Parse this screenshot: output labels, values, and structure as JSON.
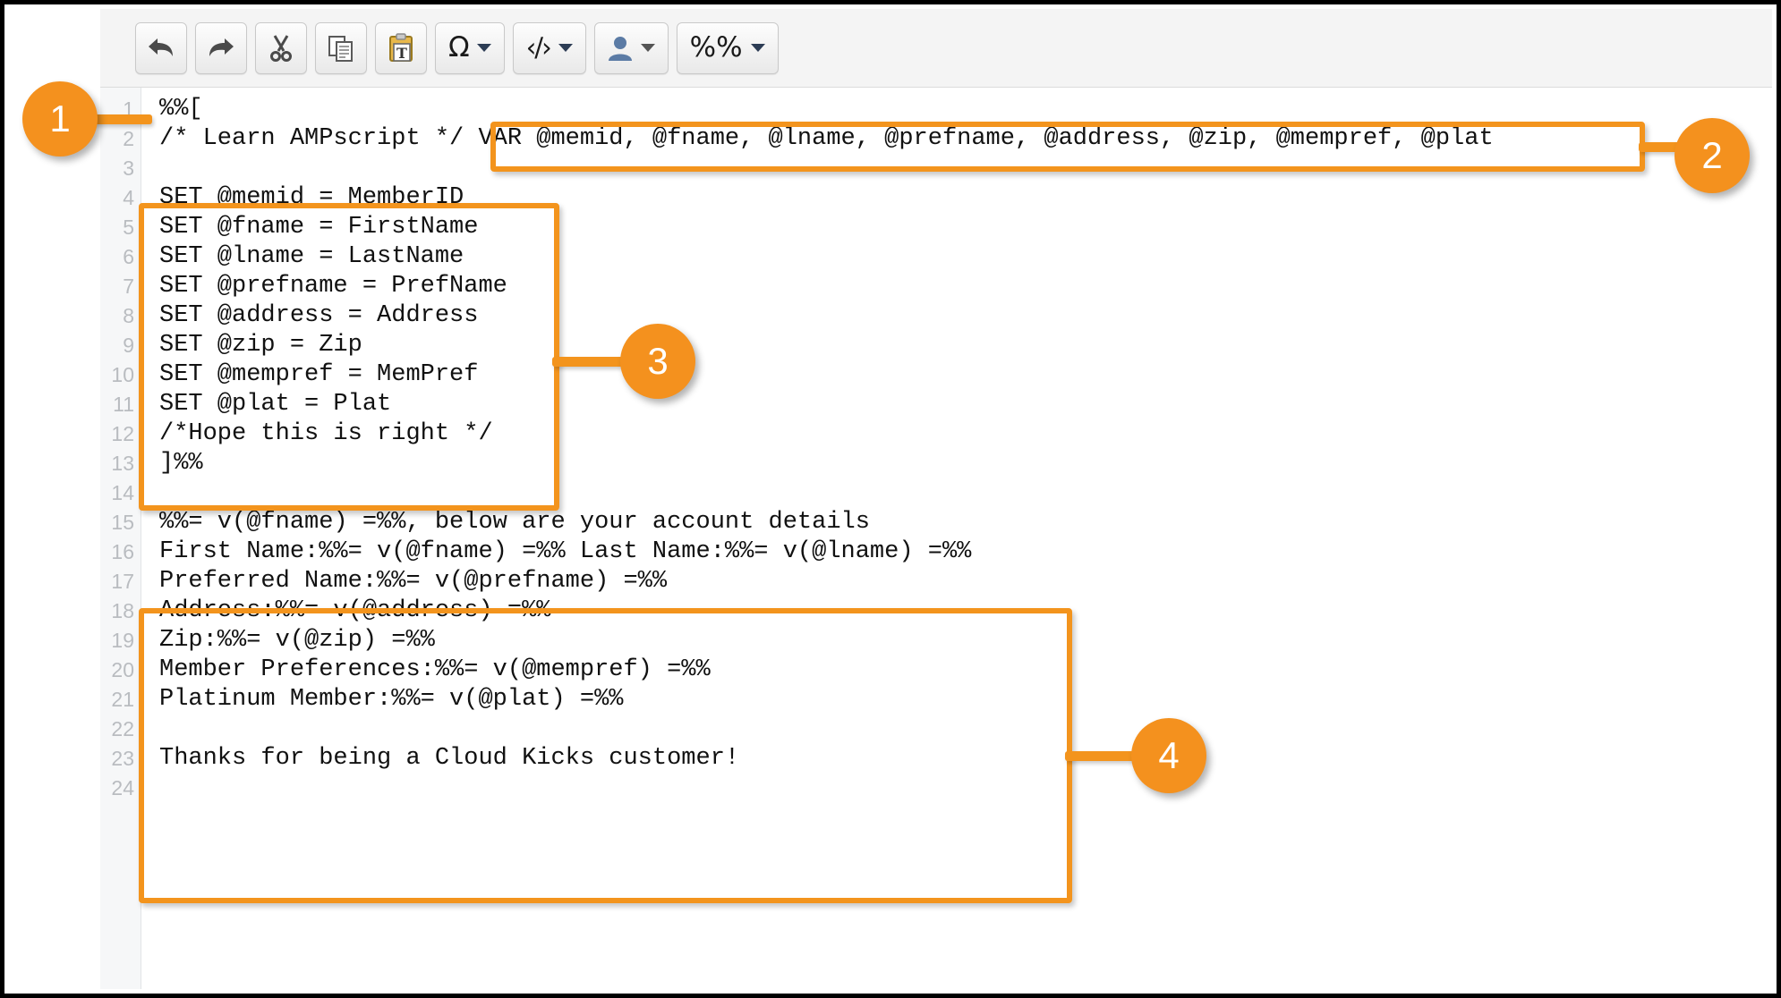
{
  "toolbar": {
    "buttons": [
      {
        "name": "undo-button",
        "icon": "undo-arrow-icon",
        "label": "",
        "caret": false
      },
      {
        "name": "redo-button",
        "icon": "redo-arrow-icon",
        "label": "",
        "caret": false
      },
      {
        "name": "cut-button",
        "icon": "scissors-icon",
        "label": "",
        "caret": false
      },
      {
        "name": "copy-button",
        "icon": "copy-documents-icon",
        "label": "",
        "caret": false
      },
      {
        "name": "paste-as-text-button",
        "icon": "clipboard-text-icon",
        "label": "",
        "caret": false
      },
      {
        "name": "special-character-button",
        "icon": "omega-icon",
        "label": "Ω",
        "caret": true
      },
      {
        "name": "source-code-button",
        "icon": "code-brackets-icon",
        "label": "‹/›",
        "caret": true
      },
      {
        "name": "personalization-button",
        "icon": "person-icon",
        "label": "",
        "caret": true
      },
      {
        "name": "ampscript-button",
        "icon": "percent-percent-icon",
        "label": "%%",
        "caret": true
      }
    ]
  },
  "editor": {
    "line_numbers": [
      "1",
      "2",
      "3",
      "4",
      "5",
      "6",
      "7",
      "8",
      "9",
      "10",
      "11",
      "12",
      "13",
      "14",
      "15",
      "16",
      "17",
      "18",
      "19",
      "20",
      "21",
      "22",
      "23",
      "24"
    ],
    "lines": [
      {
        "n": "1",
        "text": "%%["
      },
      {
        "n": "2",
        "text": "/* Learn AMPscript */ VAR @memid, @fname, @lname, @prefname, @address, @zip, @mempref, @plat"
      },
      {
        "n": "3",
        "text": ""
      },
      {
        "n": "4",
        "text": "SET @memid = MemberID"
      },
      {
        "n": "5",
        "text": "SET @fname = FirstName"
      },
      {
        "n": "6",
        "text": "SET @lname = LastName"
      },
      {
        "n": "7",
        "text": "SET @prefname = PrefName"
      },
      {
        "n": "8",
        "text": "SET @address = Address"
      },
      {
        "n": "9",
        "text": "SET @zip = Zip"
      },
      {
        "n": "10",
        "text": "SET @mempref = MemPref"
      },
      {
        "n": "11",
        "text": "SET @plat = Plat"
      },
      {
        "n": "12",
        "text": "/*Hope this is right */"
      },
      {
        "n": "13",
        "text": "]%%"
      },
      {
        "n": "14",
        "text": ""
      },
      {
        "n": "15",
        "text": "%%= v(@fname) =%%, below are your account details"
      },
      {
        "n": "16",
        "text": "First Name:%%= v(@fname) =%% Last Name:%%= v(@lname) =%%"
      },
      {
        "n": "17",
        "text": "Preferred Name:%%= v(@prefname) =%%"
      },
      {
        "n": "18",
        "text": "Address:%%= v(@address) =%%"
      },
      {
        "n": "19",
        "text": "Zip:%%= v(@zip) =%%"
      },
      {
        "n": "20",
        "text": "Member Preferences:%%= v(@mempref) =%%"
      },
      {
        "n": "21",
        "text": "Platinum Member:%%= v(@plat) =%%"
      },
      {
        "n": "22",
        "text": ""
      },
      {
        "n": "23",
        "text": "Thanks for being a Cloud Kicks customer!"
      },
      {
        "n": "24",
        "text": ""
      }
    ]
  },
  "annotations": {
    "accent_color": "#f4911e",
    "callouts": [
      {
        "label": "1",
        "target": "line-1-opening-ampscript-block"
      },
      {
        "label": "2",
        "target": "var-declaration-box"
      },
      {
        "label": "3",
        "target": "set-statements-box"
      },
      {
        "label": "4",
        "target": "output-content-box"
      }
    ]
  }
}
